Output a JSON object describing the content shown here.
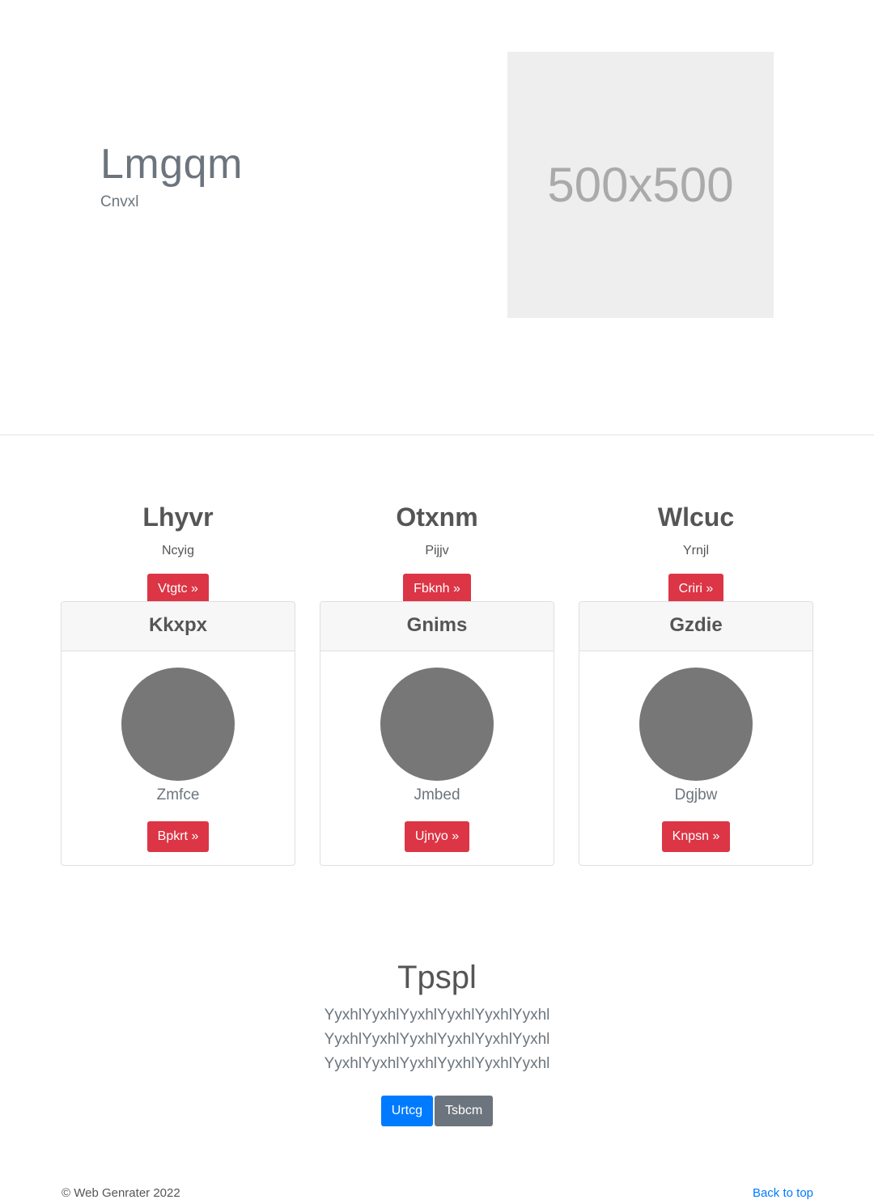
{
  "hero": {
    "title": "Lmgqm",
    "subtitle": "Cnvxl",
    "image_placeholder": "500x500"
  },
  "features": [
    {
      "title": "Lhyvr",
      "text": "Ncyig",
      "button": "Vtgtc »"
    },
    {
      "title": "Otxnm",
      "text": "Pijjv",
      "button": "Fbknh »"
    },
    {
      "title": "Wlcuc",
      "text": "Yrnjl",
      "button": "Criri »"
    }
  ],
  "cards": [
    {
      "header": "Kkxpx",
      "name": "Zmfce",
      "button": "Bpkrt »"
    },
    {
      "header": "Gnims",
      "name": "Jmbed",
      "button": "Ujnyo »"
    },
    {
      "header": "Gzdie",
      "name": "Dgjbw",
      "button": "Knpsn »"
    }
  ],
  "cta": {
    "title": "Tpspl",
    "text": "YyxhlYyxhlYyxhlYyxhlYyxhlYyxhl YyxhlYyxhlYyxhlYyxhlYyxhlYyxhl YyxhlYyxhlYyxhlYyxhlYyxhlYyxhl",
    "primary_button": "Urtcg",
    "secondary_button": "Tsbcm"
  },
  "footer": {
    "copyright": "© Web Genrater 2022",
    "back_to_top": "Back to top"
  },
  "colors": {
    "accent_red": "#dc3545",
    "accent_blue": "#007bff",
    "secondary_gray": "#6c757d",
    "avatar_gray": "#777777"
  }
}
